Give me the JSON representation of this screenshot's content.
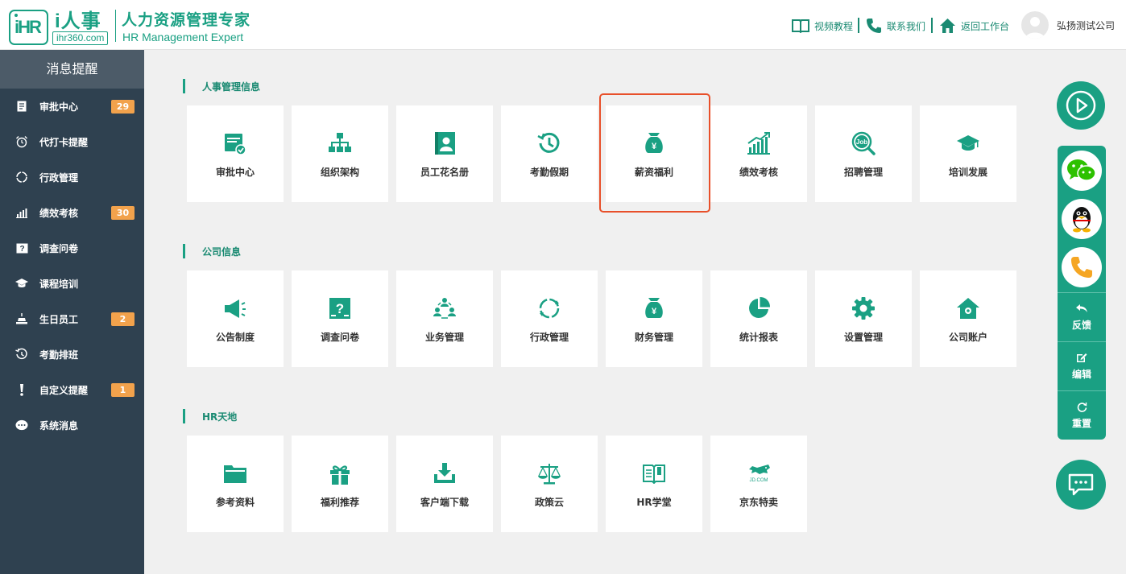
{
  "header": {
    "logo_mark": "iHR",
    "brand": "i人事",
    "url": "ihr360.com",
    "title_cn": "人力资源管理专家",
    "title_en": "HR Management Expert",
    "links": [
      "视频教程",
      "联系我们",
      "返回工作台"
    ],
    "company": "弘扬测试公司"
  },
  "sidebar": {
    "title": "消息提醒",
    "items": [
      {
        "label": "审批中心",
        "icon": "document-list-icon",
        "badge": "29"
      },
      {
        "label": "代打卡提醒",
        "icon": "alarm-clock-icon",
        "badge": ""
      },
      {
        "label": "行政管理",
        "icon": "circle-refresh-icon",
        "badge": ""
      },
      {
        "label": "绩效考核",
        "icon": "bar-chart-icon",
        "badge": "30"
      },
      {
        "label": "调查问卷",
        "icon": "survey-icon",
        "badge": ""
      },
      {
        "label": "课程培训",
        "icon": "graduation-cap-icon",
        "badge": ""
      },
      {
        "label": "生日员工",
        "icon": "birthday-cake-icon",
        "badge": "2"
      },
      {
        "label": "考勤排班",
        "icon": "history-clock-icon",
        "badge": ""
      },
      {
        "label": "自定义提醒",
        "icon": "exclamation-icon",
        "badge": "1"
      },
      {
        "label": "系统消息",
        "icon": "chat-bubble-icon",
        "badge": ""
      }
    ]
  },
  "sections": [
    {
      "title": "人事管理信息",
      "cards": [
        {
          "label": "审批中心",
          "icon": "approval-icon"
        },
        {
          "label": "组织架构",
          "icon": "org-chart-icon"
        },
        {
          "label": "员工花名册",
          "icon": "contact-book-icon"
        },
        {
          "label": "考勤假期",
          "icon": "history-clock-icon"
        },
        {
          "label": "薪资福利",
          "icon": "money-bag-icon"
        },
        {
          "label": "绩效考核",
          "icon": "growth-chart-icon"
        },
        {
          "label": "招聘管理",
          "icon": "job-search-icon"
        },
        {
          "label": "培训发展",
          "icon": "graduation-cap-icon"
        }
      ]
    },
    {
      "title": "公司信息",
      "cards": [
        {
          "label": "公告制度",
          "icon": "megaphone-icon"
        },
        {
          "label": "调查问卷",
          "icon": "survey-icon"
        },
        {
          "label": "业务管理",
          "icon": "team-network-icon"
        },
        {
          "label": "行政管理",
          "icon": "circle-refresh-icon"
        },
        {
          "label": "财务管理",
          "icon": "money-bag-icon"
        },
        {
          "label": "统计报表",
          "icon": "pie-chart-icon"
        },
        {
          "label": "设置管理",
          "icon": "gear-icon"
        },
        {
          "label": "公司账户",
          "icon": "home-account-icon"
        }
      ]
    },
    {
      "title": "HR天地",
      "cards": [
        {
          "label": "参考资料",
          "icon": "folder-icon"
        },
        {
          "label": "福利推荐",
          "icon": "gift-icon"
        },
        {
          "label": "客户端下载",
          "icon": "download-icon"
        },
        {
          "label": "政策云",
          "icon": "scales-icon"
        },
        {
          "label": "HR学堂",
          "icon": "open-book-icon"
        },
        {
          "label": "京东特卖",
          "icon": "jd-dog-icon",
          "sublabel": "JD.COM"
        }
      ]
    }
  ],
  "right_panel": {
    "buttons": [
      "反馈",
      "编辑",
      "重置"
    ]
  },
  "colors": {
    "accent": "#1aa083",
    "sidebar": "#2f4150",
    "badge": "#f2a24c",
    "highlight": "#e8502a"
  }
}
